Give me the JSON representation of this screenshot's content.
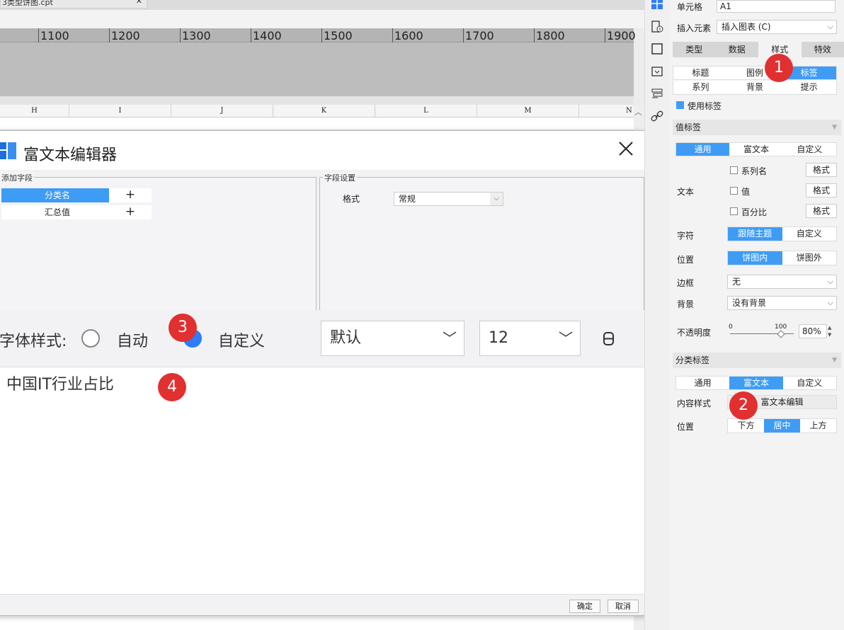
{
  "workspace": {
    "tab_title": "3类型饼图.cpt",
    "ruler_ticks": [
      "1100",
      "1200",
      "1300",
      "1400",
      "1500",
      "1600",
      "1700",
      "1800",
      "1900"
    ],
    "columns": [
      "H",
      "I",
      "J",
      "K",
      "L",
      "M",
      "N"
    ]
  },
  "dialog": {
    "title": "富文本编辑器",
    "add_field_legend": "添加字段",
    "fields": [
      {
        "name": "分类名",
        "selected": true
      },
      {
        "name": "汇总值",
        "selected": false
      }
    ],
    "add_symbol": "+",
    "field_settings_legend": "字段设置",
    "format_label": "格式",
    "format_value": "常规",
    "font_style_label": "字体样式:",
    "radio_auto": "自动",
    "radio_custom": "自定义",
    "font_family": "默认",
    "font_size": "12",
    "editor_text": "中国IT行业占比",
    "ok_button": "确定",
    "cancel_button": "取消"
  },
  "markers": [
    "1",
    "2",
    "3",
    "4"
  ],
  "panel": {
    "cell_label": "单元格",
    "cell_value": "A1",
    "insert_label": "插入元素",
    "insert_value": "插入图表 (C)",
    "tabs": [
      "类型",
      "数据",
      "样式",
      "特效"
    ],
    "active_tab": 2,
    "subtabs_row1": [
      "标题",
      "图例",
      "标签"
    ],
    "subtabs_row2": [
      "系列",
      "背景",
      "提示"
    ],
    "use_label": "使用标签",
    "value_label_section": "值标签",
    "value_seg": [
      "通用",
      "富文本",
      "自定义"
    ],
    "text_label": "文本",
    "checks": [
      "系列名",
      "值",
      "百分比"
    ],
    "format_btn": "格式",
    "char_label": "字符",
    "char_seg": [
      "跟随主题",
      "自定义"
    ],
    "position_label": "位置",
    "pos_seg": [
      "饼图内",
      "饼图外"
    ],
    "border_label": "边框",
    "border_value": "无",
    "bg_label": "背景",
    "bg_value": "没有背景",
    "opacity_label": "不透明度",
    "opacity_min": "0",
    "opacity_max": "100",
    "opacity_value": "80%",
    "opacity_level": 0.8,
    "category_section": "分类标签",
    "cat_seg": [
      "通用",
      "富文本",
      "自定义"
    ],
    "content_style_label": "内容样式",
    "rich_edit_btn": "富文本编辑",
    "cat_position_label": "位置",
    "cat_pos_seg": [
      "下方",
      "居中",
      "上方"
    ]
  }
}
